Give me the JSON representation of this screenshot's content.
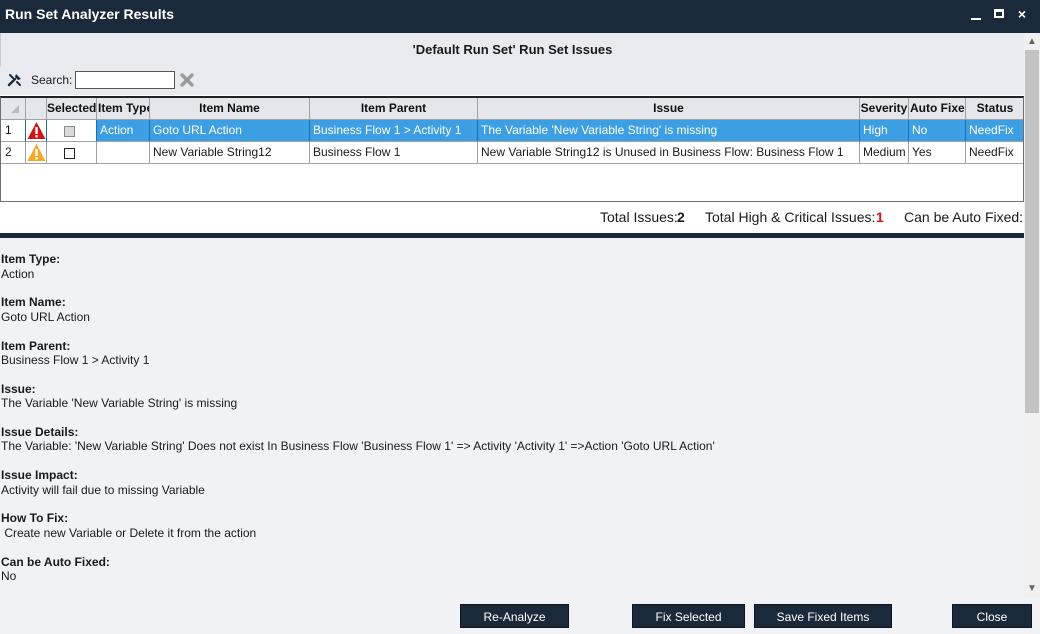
{
  "window": {
    "title": "Run Set Analyzer Results",
    "controls": [
      "minimize-icon",
      "maximize-icon",
      "close-icon"
    ],
    "close_glyph": "×"
  },
  "panel": {
    "header": "'Default Run Set' Run Set Issues"
  },
  "search": {
    "label": "Search:",
    "value": "",
    "placeholder": ""
  },
  "grid": {
    "columns": [
      "Selected",
      "Item Type",
      "Item Name",
      "Item Parent",
      "Issue",
      "Severity",
      "Auto Fixed",
      "Status"
    ],
    "rows": [
      {
        "num": "1",
        "severity_icon": "error-icon",
        "selected_checkbox": "disabled",
        "item_type": "Action",
        "item_name": "Goto URL Action",
        "item_parent": "Business Flow 1 > Activity 1",
        "issue": "The Variable 'New Variable String' is missing",
        "severity": "High",
        "auto_fixed": "No",
        "status": "NeedFix",
        "is_selected": true
      },
      {
        "num": "2",
        "severity_icon": "warning-icon",
        "selected_checkbox": "unchecked",
        "item_type": "",
        "item_name": "New Variable String12",
        "item_parent": "Business Flow 1",
        "issue": "New Variable String12 is Unused in Business Flow: Business Flow 1",
        "severity": "Medium",
        "auto_fixed": "Yes",
        "status": "NeedFix",
        "is_selected": false
      }
    ]
  },
  "summary": {
    "total_label": "Total Issues:",
    "total_value": "2",
    "high_label": "Total High & Critical Issues:",
    "high_value": "1",
    "auto_label": "Can be Auto Fixed:"
  },
  "details": {
    "item_type_label": "Item Type:",
    "item_type_value": "Action",
    "item_name_label": "Item Name:",
    "item_name_value": "Goto URL Action",
    "item_parent_label": "Item Parent:",
    "item_parent_value": "Business Flow 1 > Activity 1",
    "issue_label": "Issue:",
    "issue_value": "The Variable 'New Variable String' is missing",
    "issue_details_label": "Issue Details:",
    "issue_details_value": "The Variable: 'New Variable String' Does not exist In Business Flow 'Business Flow 1' => Activity 'Activity 1' =>Action 'Goto URL Action'",
    "issue_impact_label": "Issue Impact:",
    "issue_impact_value": "Activity will fail due to missing Variable",
    "how_to_fix_label": "How To Fix:",
    "how_to_fix_value": " Create new Variable or Delete it from the action",
    "can_auto_fix_label": "Can be Auto Fixed:",
    "can_auto_fix_value": "No"
  },
  "buttons": {
    "reanalyze": "Re-Analyze",
    "fix_selected": "Fix Selected",
    "save_fixed": "Save Fixed Items",
    "close": "Close"
  },
  "colors": {
    "titlebar": "#1b2a3b",
    "selected_row": "#3c9fe4",
    "error": "#d11414",
    "warning": "#f5a623"
  }
}
